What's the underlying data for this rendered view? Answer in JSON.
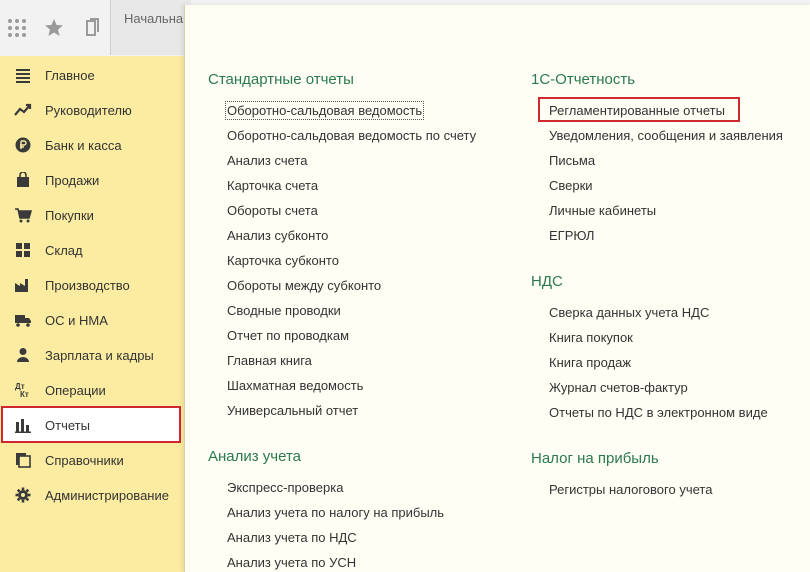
{
  "toolbar": {
    "icons": [
      "apps-grid-icon",
      "star-icon",
      "history-icon"
    ],
    "tab_start_label": "Начальна"
  },
  "sidebar": {
    "items": [
      {
        "label": "Главное",
        "icon": "menu-lines-icon"
      },
      {
        "label": "Руководителю",
        "icon": "trend-up-icon"
      },
      {
        "label": "Банк и касса",
        "icon": "ruble-coin-icon"
      },
      {
        "label": "Продажи",
        "icon": "shopping-bag-icon"
      },
      {
        "label": "Покупки",
        "icon": "cart-icon"
      },
      {
        "label": "Склад",
        "icon": "grid-icon"
      },
      {
        "label": "Производство",
        "icon": "factory-icon"
      },
      {
        "label": "ОС и НМА",
        "icon": "truck-icon"
      },
      {
        "label": "Зарплата и кадры",
        "icon": "person-icon"
      },
      {
        "label": "Операции",
        "icon": "dt-kt-icon"
      },
      {
        "label": "Отчеты",
        "icon": "bar-chart-icon"
      },
      {
        "label": "Справочники",
        "icon": "books-icon"
      },
      {
        "label": "Администрирование",
        "icon": "gear-icon"
      }
    ],
    "selected_label": "Отчеты",
    "dt_glyph_top": "Дт",
    "dt_glyph_bottom": "Кт"
  },
  "panel": {
    "col1": {
      "standard": {
        "title": "Стандартные отчеты",
        "links": [
          "Оборотно-сальдовая ведомость",
          "Оборотно-сальдовая ведомость по счету",
          "Анализ счета",
          "Карточка счета",
          "Обороты счета",
          "Анализ субконто",
          "Карточка субконто",
          "Обороты между субконто",
          "Сводные проводки",
          "Отчет по проводкам",
          "Главная книга",
          "Шахматная ведомость",
          "Универсальный отчет"
        ]
      },
      "analysis": {
        "title": "Анализ учета",
        "links": [
          "Экспресс-проверка",
          "Анализ учета по налогу на прибыль",
          "Анализ учета по НДС",
          "Анализ учета по УСН"
        ]
      }
    },
    "col2": {
      "reporting": {
        "title": "1С-Отчетность",
        "links": [
          "Регламентированные отчеты",
          "Уведомления, сообщения и заявления",
          "Письма",
          "Сверки",
          "Личные кабинеты",
          "ЕГРЮЛ"
        ]
      },
      "vat": {
        "title": "НДС",
        "links": [
          "Сверка данных учета НДС",
          "Книга покупок",
          "Книга продаж",
          "Журнал счетов-фактур",
          "Отчеты по НДС в электронном виде"
        ]
      },
      "profit": {
        "title": "Налог на прибыль",
        "links": [
          "Регистры налогового учета"
        ]
      }
    }
  },
  "colors": {
    "sidebar_bg": "#fbeca2",
    "panel_bg": "#fffef5",
    "section_title": "#2a7a4e",
    "highlight_red": "#d0282e"
  }
}
